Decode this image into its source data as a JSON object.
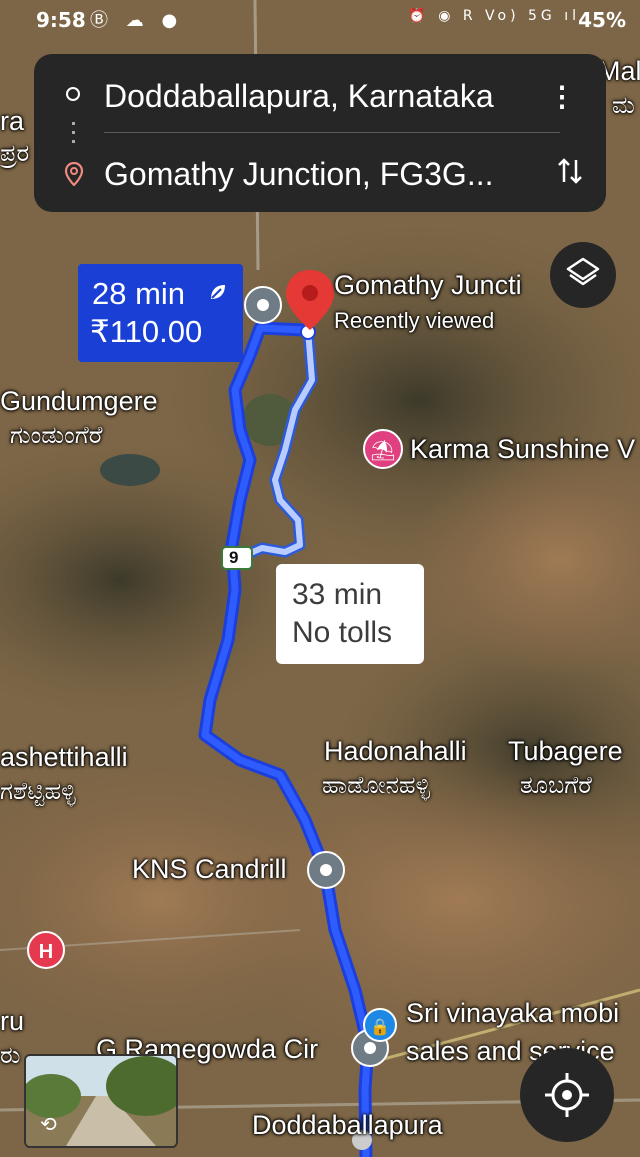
{
  "status_bar": {
    "time": "9:58",
    "left_icons": "Ⓑ ☁ ●",
    "right_icons": "⏰ ◉ R Vo) 5G ıl",
    "battery": "45%"
  },
  "directions": {
    "origin": "Doddaballapura, Karnataka",
    "destination": "Gomathy Junction, FG3G...",
    "origin_icon": "circle-origin-icon",
    "destination_icon": "location-pin-icon",
    "more_icon": "more-vertical-icon",
    "swap_icon": "swap-directions-icon"
  },
  "routes": {
    "primary": {
      "time": "28 min",
      "cost": "₹110.00",
      "eco_icon": "leaf-icon",
      "color": "#1a3fd4"
    },
    "alternate": {
      "time": "33 min",
      "note": "No tolls",
      "color": "#9fb7ff"
    }
  },
  "destination_marker": {
    "title": "Gomathy Juncti",
    "subtitle": "Recently viewed",
    "color": "#e53935"
  },
  "places": {
    "gundumgere_en": "Gundumgere",
    "gundumgere_kn": "ಗುಂಡುಂಗೆರೆ",
    "karma": "Karma Sunshine V",
    "highway": "9",
    "hadonahalli_en": "Hadonahalli",
    "hadonahalli_kn": "ಹಾಡೋನಹಳ್ಳಿ",
    "tubagere_en": "Tubagere",
    "tubagere_kn": "ತೂಬಗೆರೆ",
    "ashettihalli_en": "ashettihalli",
    "ashettihalli_kn": "ಗಶೆಟ್ಟಿಹಳ್ಳಿ",
    "kns": "KNS Candrill",
    "sri_line1": "Sri vinayaka mobi",
    "sri_line2": "sales and service",
    "ramegowda": "G Ramegowda Cir",
    "doddaballapura": "Doddaballapura",
    "edge_top_right": "Mal",
    "edge_top_right_kn": "ಮ",
    "edge_top_left": "ra",
    "edge_top_left_kn": "ಪ್ರರ",
    "edge_bottom_left": "ru",
    "edge_bottom_left_kn": "ರು"
  },
  "controls": {
    "layers_icon": "layers-icon",
    "my_location_icon": "my-location-icon",
    "street_view_icon": "street-view-rotate-icon"
  }
}
